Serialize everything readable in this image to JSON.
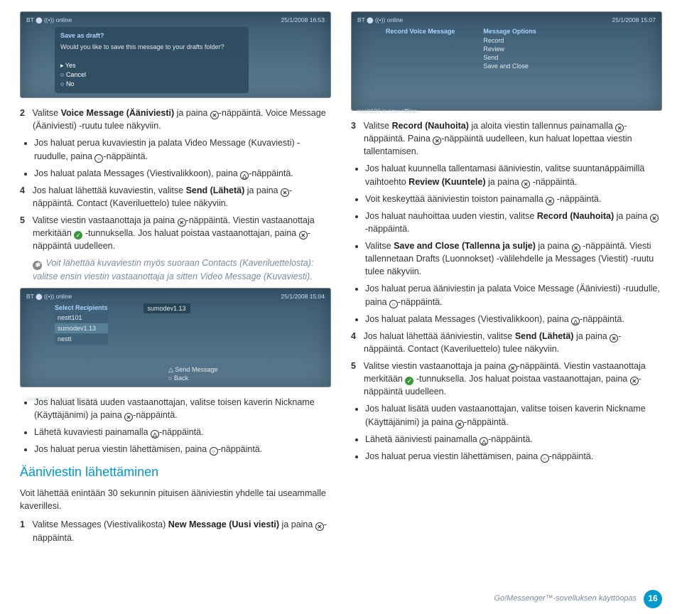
{
  "left": {
    "screenshot1": {
      "topbar_left": "BT ⬤  ((•))  online",
      "topbar_right": "25/1/2008   16:53",
      "dialog_title": "Save as draft?",
      "dialog_text": "Would you like to save this message to your drafts folder?",
      "opt_yes": "Yes",
      "opt_cancel": "Cancel",
      "opt_no": "No"
    },
    "intro_step2_a": "Valitse ",
    "intro_step2_b": "Voice Message (Ääniviesti)",
    "intro_step2_c": " ja paina ",
    "intro_step2_d": "-näppäintä. Voice Message (Ääniviesti) -ruutu tulee näkyviin.",
    "b1_a": "Jos haluat perua kuvaviestin ja palata Video Message (Kuvaviesti) -ruudulle, paina ",
    "b1_b": "-näppäintä.",
    "b2_a": "Jos haluat palata Messages (Viestivalikkoon), paina ",
    "b2_b": "-näppäintä.",
    "s4_a": "Jos haluat lähettää kuvaviestin, valitse ",
    "s4_b": "Send (Lähetä)",
    "s4_c": " ja paina ",
    "s4_d": "-näppäintä. Contact (Kaveriluettelo) tulee näkyviin.",
    "s5_a": "Valitse viestin vastaanottaja ja paina ",
    "s5_b": "-näppäintä. Viestin vastaanottaja merkitään ",
    "s5_c": " -tunnuksella. Jos haluat poistaa vastaanottajan, paina ",
    "s5_d": "-näppäintä uudelleen.",
    "note1": "Voit lähettää kuvaviestin myös suoraan Contacts (Kaveriluettelosta): valitse ensin viestin vastaanottaja ja sitten Video Message (Kuvaviesti).",
    "screenshot3": {
      "topbar_left": "BT ⬤  ((•))  online",
      "topbar_right": "25/1/2008   15:04",
      "hdr": "Select Recipients",
      "r1": "nestt101",
      "r2": "sumodev1.13",
      "r3": "nestt",
      "tag": "sumodev1.13",
      "send": "Send Message",
      "back": "Back",
      "foot": "nestt100 is now online"
    },
    "b3_a": "Jos haluat lisätä uuden vastaanottajan, valitse toisen kaverin Nickname (Käyttäjänimi) ja paina ",
    "b3_b": "-näppäintä.",
    "b4_a": "Lähetä kuvaviesti painamalla ",
    "b4_b": "-näppäintä.",
    "b5_a": "Jos haluat perua viestin lähettämisen, paina ",
    "b5_b": "-näppäintä.",
    "heading": "Ääniviestin lähettäminen",
    "lead": "Voit lähettää enintään 30 sekunnin pituisen ääniviestin yhdelle tai useammalle kaverillesi.",
    "s1_a": "Valitse Messages (Viestivalikosta) ",
    "s1_b": "New Message (Uusi viesti)",
    "s1_c": " ja paina ",
    "s1_d": "-näppäintä."
  },
  "right": {
    "screenshot2": {
      "topbar_left": "BT ⬤  ((•))  online",
      "topbar_right": "25/1/2008   15:07",
      "col1_title": "Record Voice Message",
      "col2_title": "Message Options",
      "opt1": "Record",
      "opt2": "Review",
      "opt3": "Send",
      "opt4": "Save and Close",
      "foot": "nestt100 is now offline"
    },
    "s3_a": "Valitse ",
    "s3_b": "Record (Nauhoita)",
    "s3_c": " ja aloita viestin tallennus painamalla ",
    "s3_d": "-näppäintä. Paina ",
    "s3_e": "-näppäintä uudelleen, kun haluat lopettaa viestin tallentamisen.",
    "b6_a": "Jos haluat kuunnella tallentamasi ääniviestin, valitse suuntanäppäimillä vaihtoehto ",
    "b6_b": "Review (Kuuntele)",
    "b6_c": " ja paina ",
    "b6_d": " -näppäintä.",
    "b7_a": "Voit keskeyttää ääniviestin toiston painamalla ",
    "b7_b": " -näppäintä.",
    "b8_a": "Jos haluat nauhoittaa uuden viestin, valitse ",
    "b8_b": "Record (Nauhoita)",
    "b8_c": " ja paina ",
    "b8_d": " -näppäintä.",
    "b9_a": "Valitse ",
    "b9_b": "Save and Close (Tallenna ja sulje)",
    "b9_c": " ja paina ",
    "b9_d": " -näppäintä. Viesti tallennetaan Drafts (Luonnokset) -välilehdelle ja Messages (Viestit) -ruutu tulee näkyviin.",
    "b10_a": "Jos haluat perua ääniviestin ja palata Voice Message (Ääniviesti) -ruudulle, paina ",
    "b10_b": "-näppäintä.",
    "b11_a": "Jos haluat palata Messages (Viestivalikkoon), paina ",
    "b11_b": "-näppäintä.",
    "s4r_a": "Jos haluat lähettää ääniviestin, valitse ",
    "s4r_b": "Send (Lähetä)",
    "s4r_c": " ja paina ",
    "s4r_d": "-näppäintä. Contact (Kaveriluettelo) tulee näkyviin.",
    "s5r_a": "Valitse viestin vastaanottaja ja paina ",
    "s5r_b": "-näppäintä. Viestin vastaanottaja merkitään ",
    "s5r_c": " -tunnuksella. Jos haluat poistaa vastaanottajan, paina ",
    "s5r_d": "-näppäintä uudelleen.",
    "b12_a": "Jos haluat lisätä uuden vastaanottajan, valitse toisen kaverin Nickname (Käyttäjänimi) ja paina ",
    "b12_b": "-näppäintä.",
    "b13_a": "Lähetä ääniviesti painamalla ",
    "b13_b": "-näppäintä.",
    "b14_a": "Jos haluat perua viestin lähettämisen, paina ",
    "b14_b": "-näppäintä."
  },
  "footer": {
    "text": "Go!Messenger™-sovelluksen käyttöopas",
    "page": "16"
  },
  "glyph": {
    "x": "✕",
    "o": "○",
    "tri": "△",
    "sq": "□",
    "check": "✓",
    "star": "✱"
  }
}
